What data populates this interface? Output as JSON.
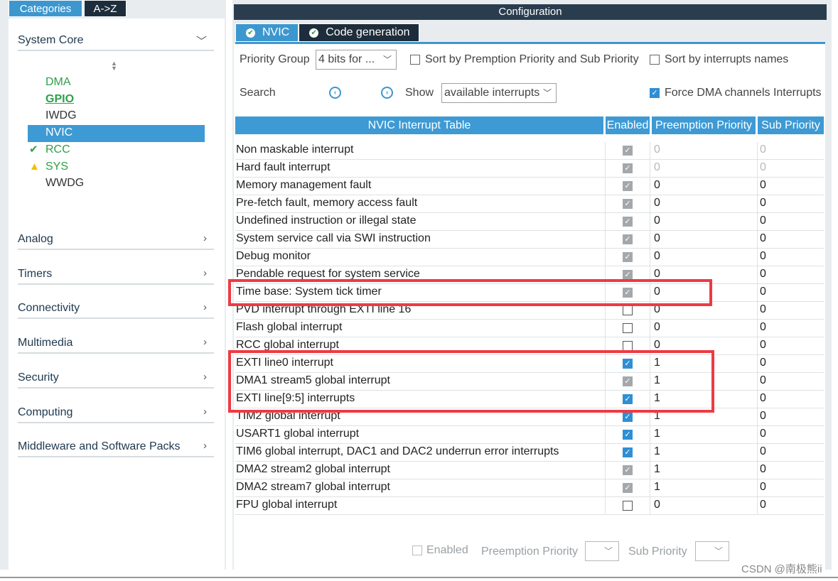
{
  "left": {
    "tabs": [
      "Categories",
      "A->Z"
    ],
    "system_core": {
      "label": "System Core",
      "items": [
        "DMA",
        "GPIO",
        "IWDG",
        "NVIC",
        "RCC",
        "SYS",
        "WWDG"
      ]
    },
    "categories": [
      "Analog",
      "Timers",
      "Connectivity",
      "Multimedia",
      "Security",
      "Computing",
      "Middleware and Software Packs"
    ]
  },
  "config": {
    "title": "Configuration",
    "tabs": [
      "NVIC",
      "Code generation"
    ],
    "priority_group_label": "Priority Group",
    "priority_group_value": "4 bits for ...",
    "sort_premption": "Sort by Premption Priority and Sub Priority",
    "sort_names": "Sort by interrupts names",
    "search_label": "Search",
    "show_label": "Show",
    "show_value": "available interrupts",
    "force_dma": "Force DMA channels Interrupts",
    "table_headers": [
      "NVIC Interrupt Table",
      "Enabled",
      "Preemption Priority",
      "Sub Priority"
    ],
    "rows": [
      {
        "name": "Non maskable interrupt",
        "pre": "0",
        "sub": "0"
      },
      {
        "name": "Hard fault interrupt",
        "pre": "0",
        "sub": "0"
      },
      {
        "name": "Memory management fault",
        "pre": "0",
        "sub": "0"
      },
      {
        "name": "Pre-fetch fault, memory access fault",
        "pre": "0",
        "sub": "0"
      },
      {
        "name": "Undefined instruction or illegal state",
        "pre": "0",
        "sub": "0"
      },
      {
        "name": "System service call via SWI instruction",
        "pre": "0",
        "sub": "0"
      },
      {
        "name": "Debug monitor",
        "pre": "0",
        "sub": "0"
      },
      {
        "name": "Pendable request for system service",
        "pre": "0",
        "sub": "0"
      },
      {
        "name": "Time base: System tick timer",
        "pre": "0",
        "sub": "0"
      },
      {
        "name": "PVD interrupt through EXTI line 16",
        "pre": "0",
        "sub": "0"
      },
      {
        "name": "Flash global interrupt",
        "pre": "0",
        "sub": "0"
      },
      {
        "name": "RCC global interrupt",
        "pre": "0",
        "sub": "0"
      },
      {
        "name": "EXTI line0 interrupt",
        "pre": "1",
        "sub": "0"
      },
      {
        "name": "DMA1 stream5 global interrupt",
        "pre": "1",
        "sub": "0"
      },
      {
        "name": "EXTI line[9:5] interrupts",
        "pre": "1",
        "sub": "0"
      },
      {
        "name": "TIM2 global interrupt",
        "pre": "1",
        "sub": "0"
      },
      {
        "name": "USART1 global interrupt",
        "pre": "1",
        "sub": "0"
      },
      {
        "name": "TIM6 global interrupt, DAC1 and DAC2 underrun error interrupts",
        "pre": "1",
        "sub": "0"
      },
      {
        "name": "DMA2 stream2 global interrupt",
        "pre": "1",
        "sub": "0"
      },
      {
        "name": "DMA2 stream7 global interrupt",
        "pre": "1",
        "sub": "0"
      },
      {
        "name": "FPU global interrupt",
        "pre": "0",
        "sub": "0"
      }
    ],
    "bottom": {
      "enabled": "Enabled",
      "preemption": "Preemption Priority",
      "sub": "Sub Priority"
    }
  },
  "watermark": "CSDN @南极熊ii"
}
